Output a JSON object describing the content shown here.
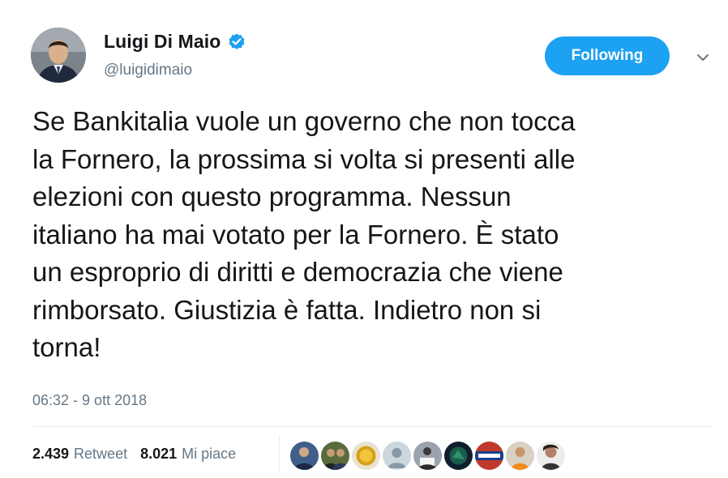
{
  "author": {
    "display_name": "Luigi Di Maio",
    "handle": "@luigidimaio",
    "verified": true
  },
  "follow_button": {
    "label": "Following"
  },
  "tweet": {
    "lines": [
      "Se Bankitalia vuole un governo che non tocca",
      "la Fornero, la prossima si volta si presenti alle",
      "elezioni con questo programma. Nessun",
      "italiano ha mai votato per la Fornero. È stato",
      "un esproprio di diritti e democrazia che viene",
      "rimborsato. Giustizia è fatta. Indietro non si",
      "torna!"
    ],
    "timestamp": "06:32 - 9 ott 2018"
  },
  "stats": {
    "retweets": {
      "count": "2.439",
      "label": "Retweet"
    },
    "likes": {
      "count": "8.021",
      "label": "Mi piace"
    }
  },
  "colors": {
    "accent": "#1da1f2",
    "text_primary": "#14171a",
    "text_secondary": "#657786",
    "divider": "#e6ecf0"
  },
  "icons": {
    "verified": "verified-badge-icon",
    "more": "chevron-down-icon"
  }
}
